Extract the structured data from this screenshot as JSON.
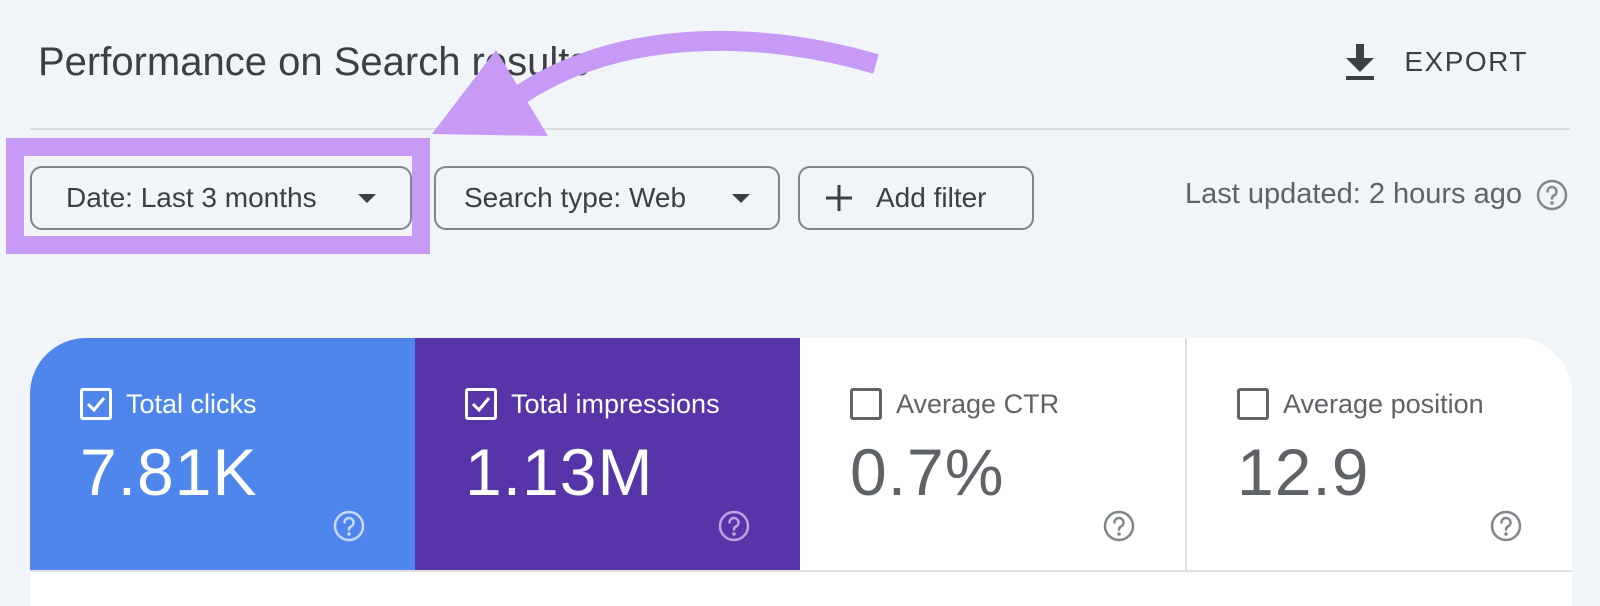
{
  "header": {
    "title": "Performance on Search results",
    "export_label": "EXPORT"
  },
  "filters": {
    "date_label": "Date: Last 3 months",
    "search_type_label": "Search type: Web",
    "add_filter_label": "Add filter"
  },
  "status": {
    "last_updated": "Last updated: 2 hours ago"
  },
  "metrics": [
    {
      "label": "Total clicks",
      "value": "7.81K",
      "checked": true,
      "color": "#4f86ec"
    },
    {
      "label": "Total impressions",
      "value": "1.13M",
      "checked": true,
      "color": "#5734a7"
    },
    {
      "label": "Average CTR",
      "value": "0.7%",
      "checked": false,
      "color": "#ffffff"
    },
    {
      "label": "Average position",
      "value": "12.9",
      "checked": false,
      "color": "#ffffff"
    }
  ],
  "annotation": {
    "highlight_color": "#c69af5"
  }
}
